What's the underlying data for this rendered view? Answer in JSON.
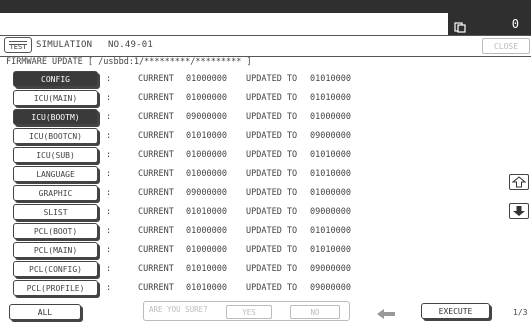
{
  "status": {
    "count": "0",
    "icon": "copy-icon"
  },
  "header": {
    "test_label": "TEST",
    "simulation_label": "SIMULATION",
    "number": "NO.49-01",
    "close_label": "CLOSE"
  },
  "path_line": "FIRMWARE UPDATE [ /usbbd:1/*********/********* ]",
  "rows": [
    {
      "label": "CONFIG",
      "selected": true,
      "sep": ":",
      "current_label": "CURRENT",
      "current": "01000000",
      "updated_label": "UPDATED TO",
      "updated": "01010000"
    },
    {
      "label": "ICU(MAIN)",
      "selected": false,
      "sep": ":",
      "current_label": "CURRENT",
      "current": "01000000",
      "updated_label": "UPDATED TO",
      "updated": "01010000"
    },
    {
      "label": "ICU(BOOTM)",
      "selected": true,
      "sep": ":",
      "current_label": "CURRENT",
      "current": "09000000",
      "updated_label": "UPDATED TO",
      "updated": "01000000"
    },
    {
      "label": "ICU(BOOTCN)",
      "selected": false,
      "sep": ":",
      "current_label": "CURRENT",
      "current": "01010000",
      "updated_label": "UPDATED TO",
      "updated": "09000000"
    },
    {
      "label": "ICU(SUB)",
      "selected": false,
      "sep": ":",
      "current_label": "CURRENT",
      "current": "01000000",
      "updated_label": "UPDATED TO",
      "updated": "01010000"
    },
    {
      "label": "LANGUAGE",
      "selected": false,
      "sep": ":",
      "current_label": "CURRENT",
      "current": "01000000",
      "updated_label": "UPDATED TO",
      "updated": "01010000"
    },
    {
      "label": "GRAPHIC",
      "selected": false,
      "sep": ":",
      "current_label": "CURRENT",
      "current": "09000000",
      "updated_label": "UPDATED TO",
      "updated": "01000000"
    },
    {
      "label": "SLIST",
      "selected": false,
      "sep": ":",
      "current_label": "CURRENT",
      "current": "01010000",
      "updated_label": "UPDATED TO",
      "updated": "09000000"
    },
    {
      "label": "PCL(BOOT)",
      "selected": false,
      "sep": ":",
      "current_label": "CURRENT",
      "current": "01000000",
      "updated_label": "UPDATED TO",
      "updated": "01010000"
    },
    {
      "label": "PCL(MAIN)",
      "selected": false,
      "sep": ":",
      "current_label": "CURRENT",
      "current": "01000000",
      "updated_label": "UPDATED TO",
      "updated": "01010000"
    },
    {
      "label": "PCL(CONFIG)",
      "selected": false,
      "sep": ":",
      "current_label": "CURRENT",
      "current": "01010000",
      "updated_label": "UPDATED TO",
      "updated": "09000000"
    },
    {
      "label": "PCL(PROFILE)",
      "selected": false,
      "sep": ":",
      "current_label": "CURRENT",
      "current": "01010000",
      "updated_label": "UPDATED TO",
      "updated": "09000000"
    }
  ],
  "footer": {
    "all_label": "ALL",
    "confirm_prompt": "ARE YOU SURE?",
    "yes_label": "YES",
    "no_label": "NO",
    "execute_label": "EXECUTE",
    "page_indicator": "1/3"
  },
  "colors": {
    "dark": "#2f2f2f",
    "selected_button": "#3a3a3a",
    "disabled": "#bbbbbb"
  }
}
